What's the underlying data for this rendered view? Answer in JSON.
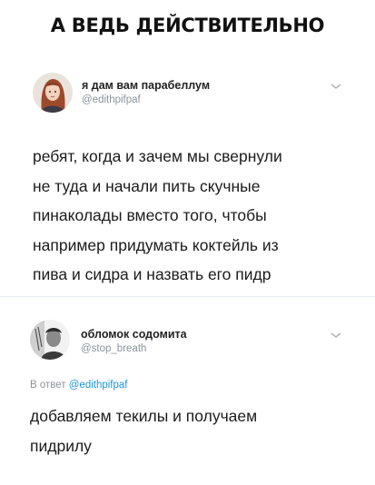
{
  "caption": "А ВЕДЬ ДЕЙСТВИТЕЛЬНО",
  "main_tweet": {
    "name": "я дам вам парабеллум",
    "handle": "@edithpifpaf",
    "avatar_icon": "woman-portrait-avatar",
    "menu_icon": "chevron-down-icon",
    "lines": [
      "ребят, когда и зачем мы свернули",
      "не туда и начали пить скучные",
      "пинаколады вместо того, чтобы",
      "например придумать коктейль из",
      "пива и сидра и назвать его пидр"
    ]
  },
  "reply_tweet": {
    "name": "обломок содомита",
    "handle": "@stop_breath",
    "avatar_icon": "man-portrait-avatar",
    "menu_icon": "chevron-down-icon",
    "reply_prefix": "В ответ",
    "reply_mention": "@edithpifpaf",
    "lines": [
      "добавляем текилы и получаем",
      "пидрилу"
    ]
  },
  "colors": {
    "mention": "#1b95e0",
    "muted": "#8a949c",
    "divider": "#e6ecf0"
  }
}
